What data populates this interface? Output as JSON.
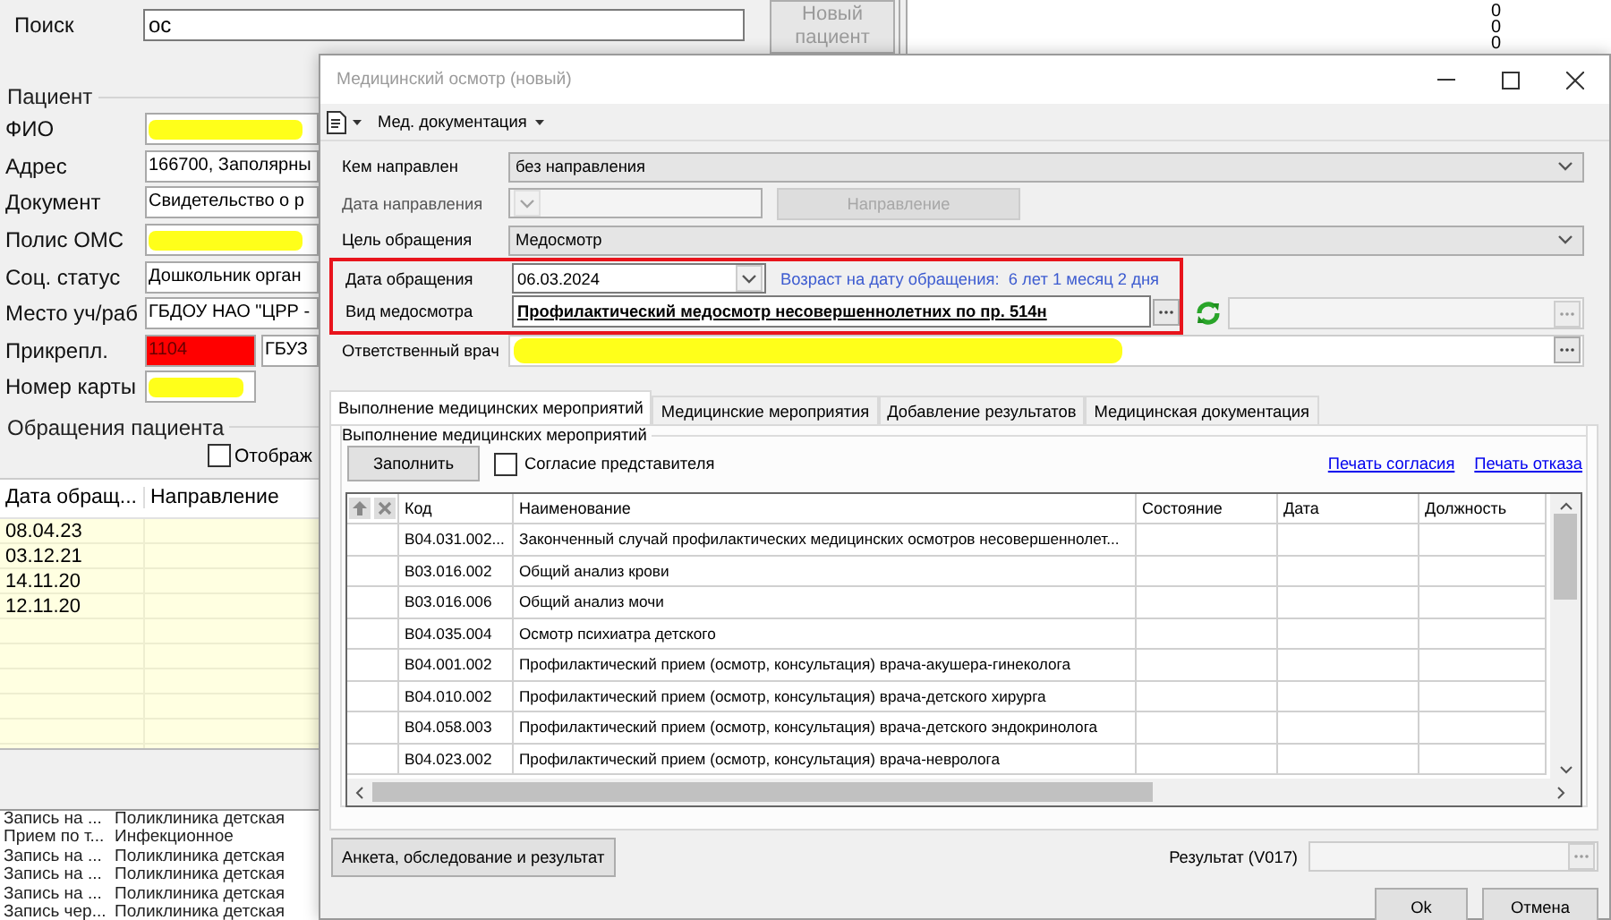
{
  "app": {
    "search": {
      "label": "Поиск",
      "value": "ос"
    },
    "new_patient_button": {
      "label": "Новый пациент",
      "disabled": true
    },
    "counters": [
      "0",
      "0",
      "0"
    ],
    "patient": {
      "title": "Пациент",
      "fields": [
        {
          "label": "ФИО",
          "kind": "redacted"
        },
        {
          "label": "Адрес",
          "kind": "text",
          "value": "166700, Заполярны"
        },
        {
          "label": "Документ",
          "kind": "text",
          "value": "Свидетельство о р"
        },
        {
          "label": "Полис ОМС",
          "kind": "redacted"
        },
        {
          "label": "Соц. статус",
          "kind": "text",
          "value": "Дошкольник орган"
        },
        {
          "label": "Место уч/раб",
          "kind": "text",
          "value": "ГБДОУ НАО \"ЦРР -"
        },
        {
          "label": "Прикрепл.",
          "kind": "alert",
          "value": "1104",
          "value_2": "ГБУЗ"
        },
        {
          "label": "Номер карты",
          "kind": "redacted_short"
        }
      ]
    },
    "visits": {
      "title": "Обращения пациента",
      "checkbox": {
        "label": "Отображ",
        "checked": false
      },
      "columns": [
        "Дата обращ...",
        "Направление"
      ],
      "rows": [
        "08.04.23",
        "03.12.21",
        "14.11.20",
        "12.11.20"
      ]
    },
    "log": [
      {
        "column_1": "Запись на ...",
        "column_2": "Поликлиника детская"
      },
      {
        "column_1": "Прием по т...",
        "column_2": "Инфекционное"
      },
      {
        "column_1": "Запись на ...",
        "column_2": "Поликлиника детская"
      },
      {
        "column_1": "Запись на ...",
        "column_2": "Поликлиника детская"
      },
      {
        "column_1": "Запись на ...",
        "column_2": "Поликлиника детская"
      },
      {
        "column_1": "Запись чер...",
        "column_2": "Поликлиника детская"
      }
    ]
  },
  "dialog": {
    "title": "Медицинский осмотр (новый)",
    "toolbar": {
      "menu": "Мед. документация"
    },
    "form": [
      {
        "label": "Кем направлен",
        "kind": "combo",
        "value": "без направления",
        "disabled": false,
        "highlighted": false
      },
      {
        "label": "Дата направления",
        "kind": "date_button",
        "button": "Направление",
        "disabled": true,
        "highlighted": false
      },
      {
        "label": "Цель обращения",
        "kind": "combo",
        "value": "Медосмотр",
        "disabled": false,
        "highlighted": false
      },
      {
        "label": "Дата обращения",
        "kind": "date",
        "value": "06.03.2024",
        "note": "Возраст на дату обращения:  6 лет 1 месяц 2 дня",
        "disabled": false,
        "highlighted": true
      },
      {
        "label": "Вид медосмотра",
        "kind": "lookup",
        "value": "Профилактический медосмотр несовершеннолетних по пр. 514н",
        "disabled": false,
        "highlighted": true
      },
      {
        "label": "Ответственный врач",
        "kind": "redacted_lookup",
        "disabled": false,
        "highlighted": false
      }
    ],
    "tabs": [
      {
        "label": "Выполнение медицинских мероприятий",
        "selected": true
      },
      {
        "label": "Медицинские мероприятия",
        "selected": false
      },
      {
        "label": "Добавление результатов",
        "selected": false
      },
      {
        "label": "Медицинская документация",
        "selected": false
      }
    ],
    "panel": {
      "group_title": "Выполнение медицинских мероприятий",
      "fill_button": "Заполнить",
      "consent": {
        "label": "Согласие представителя",
        "checked": false
      },
      "links": [
        "Печать согласия",
        "Печать отказа"
      ],
      "table": {
        "columns": [
          "Код",
          "Наименование",
          "Состояние",
          "Дата",
          "Должность"
        ],
        "rows": [
          {
            "code": "B04.031.002...",
            "name": "Законченный случай профилактических медицинских осмотров несовершеннолет..."
          },
          {
            "code": "B03.016.002",
            "name": "Общий анализ крови"
          },
          {
            "code": "B03.016.006",
            "name": "Общий анализ мочи"
          },
          {
            "code": "B04.035.004",
            "name": "Осмотр психиатра детского"
          },
          {
            "code": "B04.001.002",
            "name": "Профилактический прием (осмотр, консультация) врача-акушера-гинеколога"
          },
          {
            "code": "B04.010.002",
            "name": "Профилактический прием (осмотр, консультация) врача-детского хирурга"
          },
          {
            "code": "B04.058.003",
            "name": "Профилактический прием (осмотр, консультация) врача-детского эндокринолога"
          },
          {
            "code": "B04.023.002",
            "name": "Профилактический прием (осмотр, консультация) врача-невролога"
          }
        ]
      }
    },
    "survey_button": "Анкета, обследование и результат",
    "result": {
      "label": "Результат (V017)"
    },
    "buttons": [
      "Ok",
      "Отмена"
    ]
  }
}
